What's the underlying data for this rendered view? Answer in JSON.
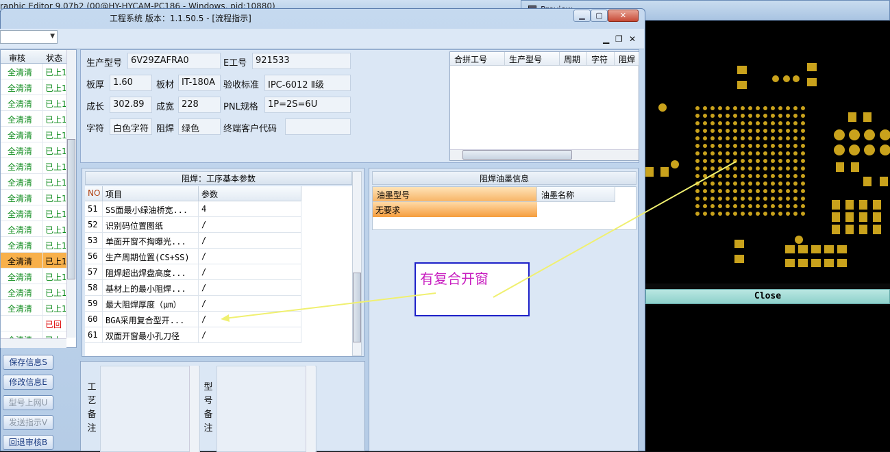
{
  "bg_window": {
    "title": "raphic Editor 9.07b2 (00@HY-HYCAM-PC186 - Windows, pid:10880)",
    "second_title": "Preview"
  },
  "window": {
    "title": "工程系统   版本：1.1.50.5 - [流程指示]",
    "buttons": {
      "minimize": "▁",
      "maximize": "▢",
      "close": "✕"
    },
    "mdi_buttons": {
      "minimize": "▁",
      "restore": "❐",
      "close": "✕"
    }
  },
  "left_list": {
    "headers": [
      "审核",
      "状态"
    ],
    "rows": [
      {
        "review": "全清清",
        "status": "已上1"
      },
      {
        "review": "全清清",
        "status": "已上1"
      },
      {
        "review": "全清清",
        "status": "已上1"
      },
      {
        "review": "全清清",
        "status": "已上1"
      },
      {
        "review": "全清清",
        "status": "已上1"
      },
      {
        "review": "全清清",
        "status": "已上1"
      },
      {
        "review": "全清清",
        "status": "已上1"
      },
      {
        "review": "全清清",
        "status": "已上1"
      },
      {
        "review": "全清清",
        "status": "已上1"
      },
      {
        "review": "全清清",
        "status": "已上1"
      },
      {
        "review": "全清清",
        "status": "已上1"
      },
      {
        "review": "全清清",
        "status": "已上1"
      },
      {
        "review": "全清清",
        "status": "已上1"
      },
      {
        "review": "全清清",
        "status": "已上1"
      },
      {
        "review": "全清清",
        "status": "已上1"
      },
      {
        "review": "全清清",
        "status": "已上1"
      },
      {
        "review": "",
        "status": "已回"
      },
      {
        "review": "全清清",
        "status": "已上"
      }
    ],
    "selected_index": 12
  },
  "left_buttons": [
    {
      "label": "保存信息S",
      "enabled": true
    },
    {
      "label": "修改信息E",
      "enabled": true
    },
    {
      "label": "型号上网U",
      "enabled": false
    },
    {
      "label": "发送指示V",
      "enabled": false
    },
    {
      "label": "回退审核B",
      "enabled": true
    }
  ],
  "info": {
    "model_label": "生产型号",
    "model": "6V29ZAFRA0",
    "e_label": "E工号",
    "e_no": "921533",
    "thickness_label": "板厚",
    "thickness": "1.60",
    "material_label": "板材",
    "material": "IT-180A",
    "standard_label": "验收标准",
    "standard": "IPC-6012 Ⅱ级",
    "length_label": "成长",
    "length": "302.89",
    "width_label": "成宽",
    "width": "228",
    "pnl_label": "PNL规格",
    "pnl": "1P=2S=6U",
    "char_label": "字符",
    "char": "白色字符",
    "mask_label": "阻焊",
    "mask": "绿色",
    "customer_label": "终端客户代码",
    "customer": ""
  },
  "merge_grid": {
    "headers": [
      "合拼工号",
      "生产型号",
      "周期",
      "字符",
      "阻焊"
    ]
  },
  "params": {
    "title": "阻焊：工序基本参数",
    "headers": [
      "NO",
      "项目",
      "参数"
    ],
    "rows": [
      {
        "no": "51",
        "item": "SS面最小绿油桥宽...",
        "value": "4"
      },
      {
        "no": "52",
        "item": "识别码位置图纸",
        "value": "/"
      },
      {
        "no": "53",
        "item": "单面开窗不掏曝光...",
        "value": "/"
      },
      {
        "no": "56",
        "item": "生产周期位置(CS+SS)",
        "value": "/"
      },
      {
        "no": "57",
        "item": "阻焊超出焊盘高度...",
        "value": "/"
      },
      {
        "no": "58",
        "item": "基材上的最小阻焊...",
        "value": "/"
      },
      {
        "no": "59",
        "item": "最大阻焊厚度（μm）",
        "value": "/"
      },
      {
        "no": "60",
        "item": "BGA采用复合型开...",
        "value": "/"
      },
      {
        "no": "61",
        "item": "双面开窗最小孔刀径",
        "value": "/"
      }
    ]
  },
  "ink": {
    "title": "阻焊油墨信息",
    "headers": [
      "油墨型号",
      "油墨名称"
    ],
    "row": {
      "model": "无要求",
      "name": ""
    }
  },
  "remarks": {
    "process_label": "工艺备注",
    "model_label": "型号备注"
  },
  "preview": {
    "close_label": "Close"
  },
  "annotation": {
    "text": "有复合开窗",
    "color": "#c81fc0",
    "border_color": "#1d20c8",
    "arrow_color": "#f0f070"
  },
  "colors": {
    "pad": "#c9a21c",
    "green_text": "#0b8a1a",
    "selected_row": "#f8b04a"
  }
}
